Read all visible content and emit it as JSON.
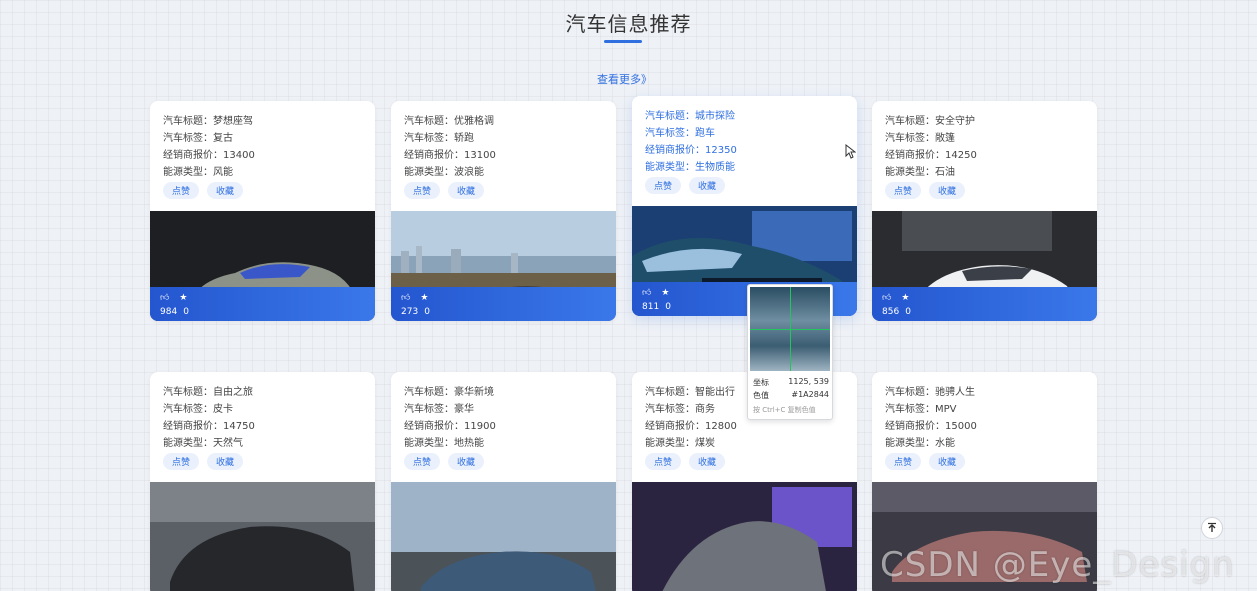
{
  "section": {
    "title": "汽车信息推荐",
    "more_label": "查看更多》"
  },
  "labels": {
    "title": "汽车标题：",
    "tag": "汽车标签：",
    "price": "经销商报价：",
    "energy": "能源类型：",
    "like_btn": "点赞",
    "fav_btn": "收藏"
  },
  "cards": [
    {
      "title": "梦想座驾",
      "tag": "复古",
      "price": "13400",
      "energy": "风能",
      "likes": "984",
      "favs": "0"
    },
    {
      "title": "优雅格调",
      "tag": "轿跑",
      "price": "13100",
      "energy": "波浪能",
      "likes": "273",
      "favs": "0"
    },
    {
      "title": "城市探险",
      "tag": "跑车",
      "price": "12350",
      "energy": "生物质能",
      "likes": "811",
      "favs": "0"
    },
    {
      "title": "安全守护",
      "tag": "敞篷",
      "price": "14250",
      "energy": "石油",
      "likes": "856",
      "favs": "0"
    },
    {
      "title": "自由之旅",
      "tag": "皮卡",
      "price": "14750",
      "energy": "天然气"
    },
    {
      "title": "豪华新境",
      "tag": "豪华",
      "price": "11900",
      "energy": "地热能"
    },
    {
      "title": "智能出行",
      "tag": "商务",
      "price": "12800",
      "energy": "煤炭"
    },
    {
      "title": "驰骋人生",
      "tag": "MPV",
      "price": "15000",
      "energy": "水能"
    }
  ],
  "color_picker": {
    "coord_label": "坐标",
    "coord_value": "1125, 539",
    "color_label": "色值",
    "color_value": "#1A2844",
    "hint": "按 Ctrl+C 复制色值"
  },
  "watermark": "CSDN @Eye_Design",
  "colors": {
    "accent": "#2f6fe0",
    "stats_bar": "#2456cf"
  }
}
